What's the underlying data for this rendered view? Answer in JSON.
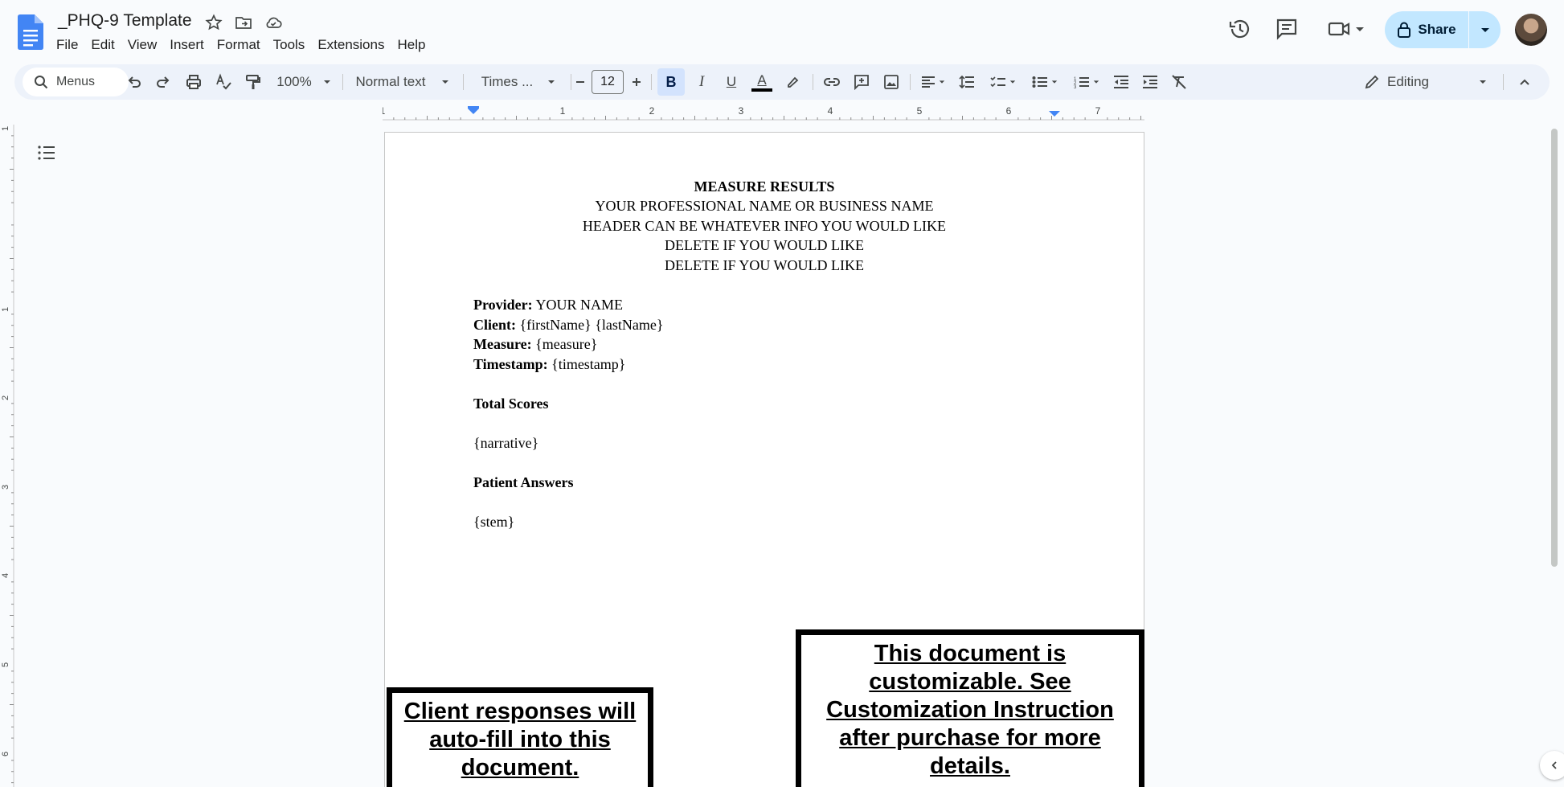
{
  "doc_title": "_PHQ-9 Template",
  "menu": [
    "File",
    "Edit",
    "View",
    "Insert",
    "Format",
    "Tools",
    "Extensions",
    "Help"
  ],
  "share_label": "Share",
  "toolbar": {
    "search_label": "Menus",
    "zoom": "100%",
    "style": "Normal text",
    "font": "Times ...",
    "font_size": "12",
    "bold": "B",
    "italic": "I",
    "underline": "U",
    "text_color": "A",
    "mode": "Editing"
  },
  "ruler": {
    "h_labels": [
      "1",
      "1",
      "2",
      "3",
      "4",
      "5",
      "6",
      "7"
    ],
    "v_labels": [
      "1",
      "1",
      "2",
      "3",
      "4",
      "5",
      "6"
    ]
  },
  "document": {
    "header_lines": [
      "MEASURE RESULTS",
      "YOUR PROFESSIONAL NAME OR BUSINESS NAME",
      "HEADER CAN BE WHATEVER INFO YOU WOULD LIKE",
      "DELETE IF YOU WOULD LIKE",
      "DELETE IF YOU WOULD LIKE"
    ],
    "fields": [
      {
        "label": "Provider:",
        "value": "YOUR NAME"
      },
      {
        "label": "Client:",
        "value": "{firstName} {lastName}"
      },
      {
        "label": "Measure:",
        "value": "{measure}"
      },
      {
        "label": "Timestamp:",
        "value": "{timestamp}"
      }
    ],
    "total_scores_heading": "Total Scores",
    "narrative": "{narrative}",
    "patient_answers_heading": "Patient Answers",
    "stem": "{stem}"
  },
  "callouts": {
    "left": "Client responses will auto-fill into this document.",
    "right": "This document is customizable. See Customization Instruction after purchase for more details."
  },
  "colors": {
    "accent": "#c2e7ff",
    "toolbar_bg": "#edf2fa",
    "doc_icon": "#4285f4"
  }
}
